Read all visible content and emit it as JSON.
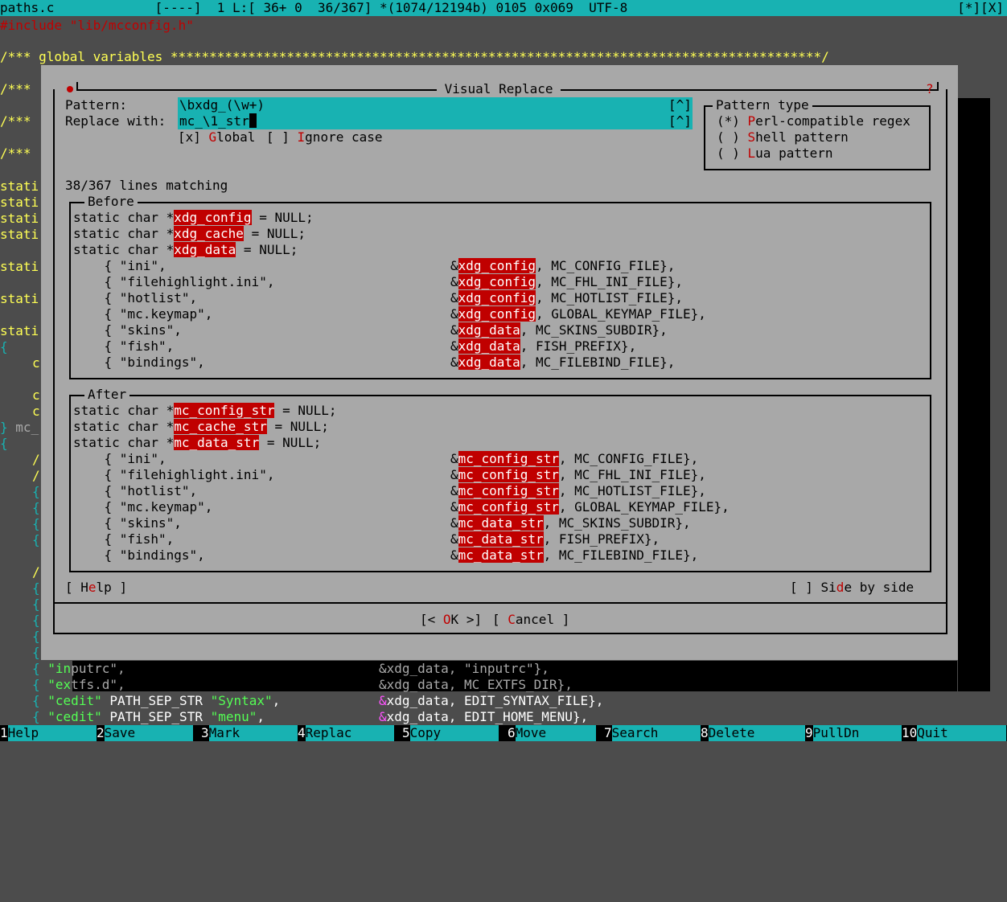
{
  "statusbar": {
    "filename": "paths.c",
    "mode": "[----]",
    "info": "1 L:[ 36+ 0  36/367] *(1074/12194b) 0105 0x069  UTF-8",
    "corner": "[*][X]"
  },
  "editor": {
    "include_kw": "#include",
    "include_path": "\"lib/mcconfig.h\"",
    "comment_global": "/*** global variables ************************************************************************************/",
    "comment_a": "/***",
    "comment_b": "/***",
    "comment_c": "/***",
    "stati": "stati",
    "brace_open": "{",
    "brace_close": "}",
    "mc_frag": " mc_",
    "c_frag": "c",
    "slashes": "/",
    "bottom": [
      {
        "brace": "{",
        "str": "\"in",
        "str2": "putrc\"",
        "comma": ",",
        "ref": "&xdg_data, \"inputrc\"},"
      },
      {
        "brace": "{",
        "str": "\"ex",
        "str2": "tfs.d\"",
        "comma": ",",
        "ref": "&xdg_data, MC_EXTFS_DIR},"
      },
      {
        "brace": "{",
        "str": "\"cedit\"",
        "mid": "PATH_SEP_STR",
        "str3": "\"Syntax\"",
        "comma": ",",
        "amp": "&",
        "ref": "xdg_data, EDIT_SYNTAX_FILE},"
      },
      {
        "brace": "{",
        "str": "\"cedit\"",
        "mid": "PATH_SEP_STR",
        "str3": "\"menu\"",
        "comma": ",",
        "amp": "&",
        "ref": "xdg_data, EDIT_HOME_MENU},"
      }
    ]
  },
  "dialog": {
    "title": " Visual Replace ",
    "help_mark": "?",
    "pattern_label": "Pattern:",
    "pattern_value": "\\bxdg_(\\w+)",
    "replace_label": "Replace with:",
    "replace_value": "mc_\\1_str",
    "history_btn": "[^]",
    "global_pre": "[x] ",
    "global_hot": "G",
    "global_rest": "lobal",
    "ignore_pre": "[ ] ",
    "ignore_hot": "I",
    "ignore_rest": "gnore case",
    "pattern_type": {
      "title": "Pattern type",
      "options": [
        {
          "mark": "(*) ",
          "hot": "P",
          "rest": "erl-compatible regex"
        },
        {
          "mark": "( ) ",
          "hot": "S",
          "rest": "hell pattern"
        },
        {
          "mark": "( ) ",
          "hot": "L",
          "rest": "ua pattern"
        }
      ]
    },
    "match_count": "38/367 lines matching",
    "before": {
      "title": "Before",
      "decls": [
        {
          "pre": "static char *",
          "hl": "xdg_config",
          "post": " = NULL;"
        },
        {
          "pre": "static char *",
          "hl": "xdg_cache",
          "post": " = NULL;"
        },
        {
          "pre": "static char *",
          "hl": "xdg_data",
          "post": " = NULL;"
        }
      ],
      "rows": [
        {
          "left": "    { \"ini\",",
          "hl": "xdg_config",
          "post": ", MC_CONFIG_FILE},"
        },
        {
          "left": "    { \"filehighlight.ini\",",
          "hl": "xdg_config",
          "post": ", MC_FHL_INI_FILE},"
        },
        {
          "left": "    { \"hotlist\",",
          "hl": "xdg_config",
          "post": ", MC_HOTLIST_FILE},"
        },
        {
          "left": "    { \"mc.keymap\",",
          "hl": "xdg_config",
          "post": ", GLOBAL_KEYMAP_FILE},"
        },
        {
          "left": "    { \"skins\",",
          "hl": "xdg_data",
          "post": ", MC_SKINS_SUBDIR},"
        },
        {
          "left": "    { \"fish\",",
          "hl": "xdg_data",
          "post": ", FISH_PREFIX},"
        },
        {
          "left": "    { \"bindings\",",
          "hl": "xdg_data",
          "post": ", MC_FILEBIND_FILE},"
        }
      ]
    },
    "after": {
      "title": "After",
      "decls": [
        {
          "pre": "static char *",
          "hl": "mc_config_str",
          "post": " = NULL;"
        },
        {
          "pre": "static char *",
          "hl": "mc_cache_str",
          "post": " = NULL;"
        },
        {
          "pre": "static char *",
          "hl": "mc_data_str",
          "post": " = NULL;"
        }
      ],
      "rows": [
        {
          "left": "    { \"ini\",",
          "hl": "mc_config_str",
          "post": ", MC_CONFIG_FILE},"
        },
        {
          "left": "    { \"filehighlight.ini\",",
          "hl": "mc_config_str",
          "post": ", MC_FHL_INI_FILE},"
        },
        {
          "left": "    { \"hotlist\",",
          "hl": "mc_config_str",
          "post": ", MC_HOTLIST_FILE},"
        },
        {
          "left": "    { \"mc.keymap\",",
          "hl": "mc_config_str",
          "post": ", GLOBAL_KEYMAP_FILE},"
        },
        {
          "left": "    { \"skins\",",
          "hl": "mc_data_str",
          "post": ", MC_SKINS_SUBDIR},"
        },
        {
          "left": "    { \"fish\",",
          "hl": "mc_data_str",
          "post": ", FISH_PREFIX},"
        },
        {
          "left": "    { \"bindings\",",
          "hl": "mc_data_str",
          "post": ", MC_FILEBIND_FILE},"
        }
      ]
    },
    "amp": "&",
    "help_pre": "[ H",
    "help_hot": "e",
    "help_post": "lp ]",
    "sbs_pre": "[ ] Si",
    "sbs_hot": "d",
    "sbs_post": "e by side",
    "ok_pre": "[< ",
    "ok_hot": "O",
    "ok_post": "K >]",
    "cancel_pre": "[ ",
    "cancel_hot": "C",
    "cancel_post": "ancel ]"
  },
  "fkeys": [
    {
      "num": "1",
      "label": "Help"
    },
    {
      "num": "2",
      "label": "Save"
    },
    {
      "num": "3",
      "label": "Mark"
    },
    {
      "num": "4",
      "label": "Replac"
    },
    {
      "num": "5",
      "label": "Copy"
    },
    {
      "num": "6",
      "label": "Move"
    },
    {
      "num": "7",
      "label": "Search"
    },
    {
      "num": "8",
      "label": "Delete"
    },
    {
      "num": "9",
      "label": "PullDn"
    },
    {
      "num": "10",
      "label": "Quit"
    }
  ]
}
